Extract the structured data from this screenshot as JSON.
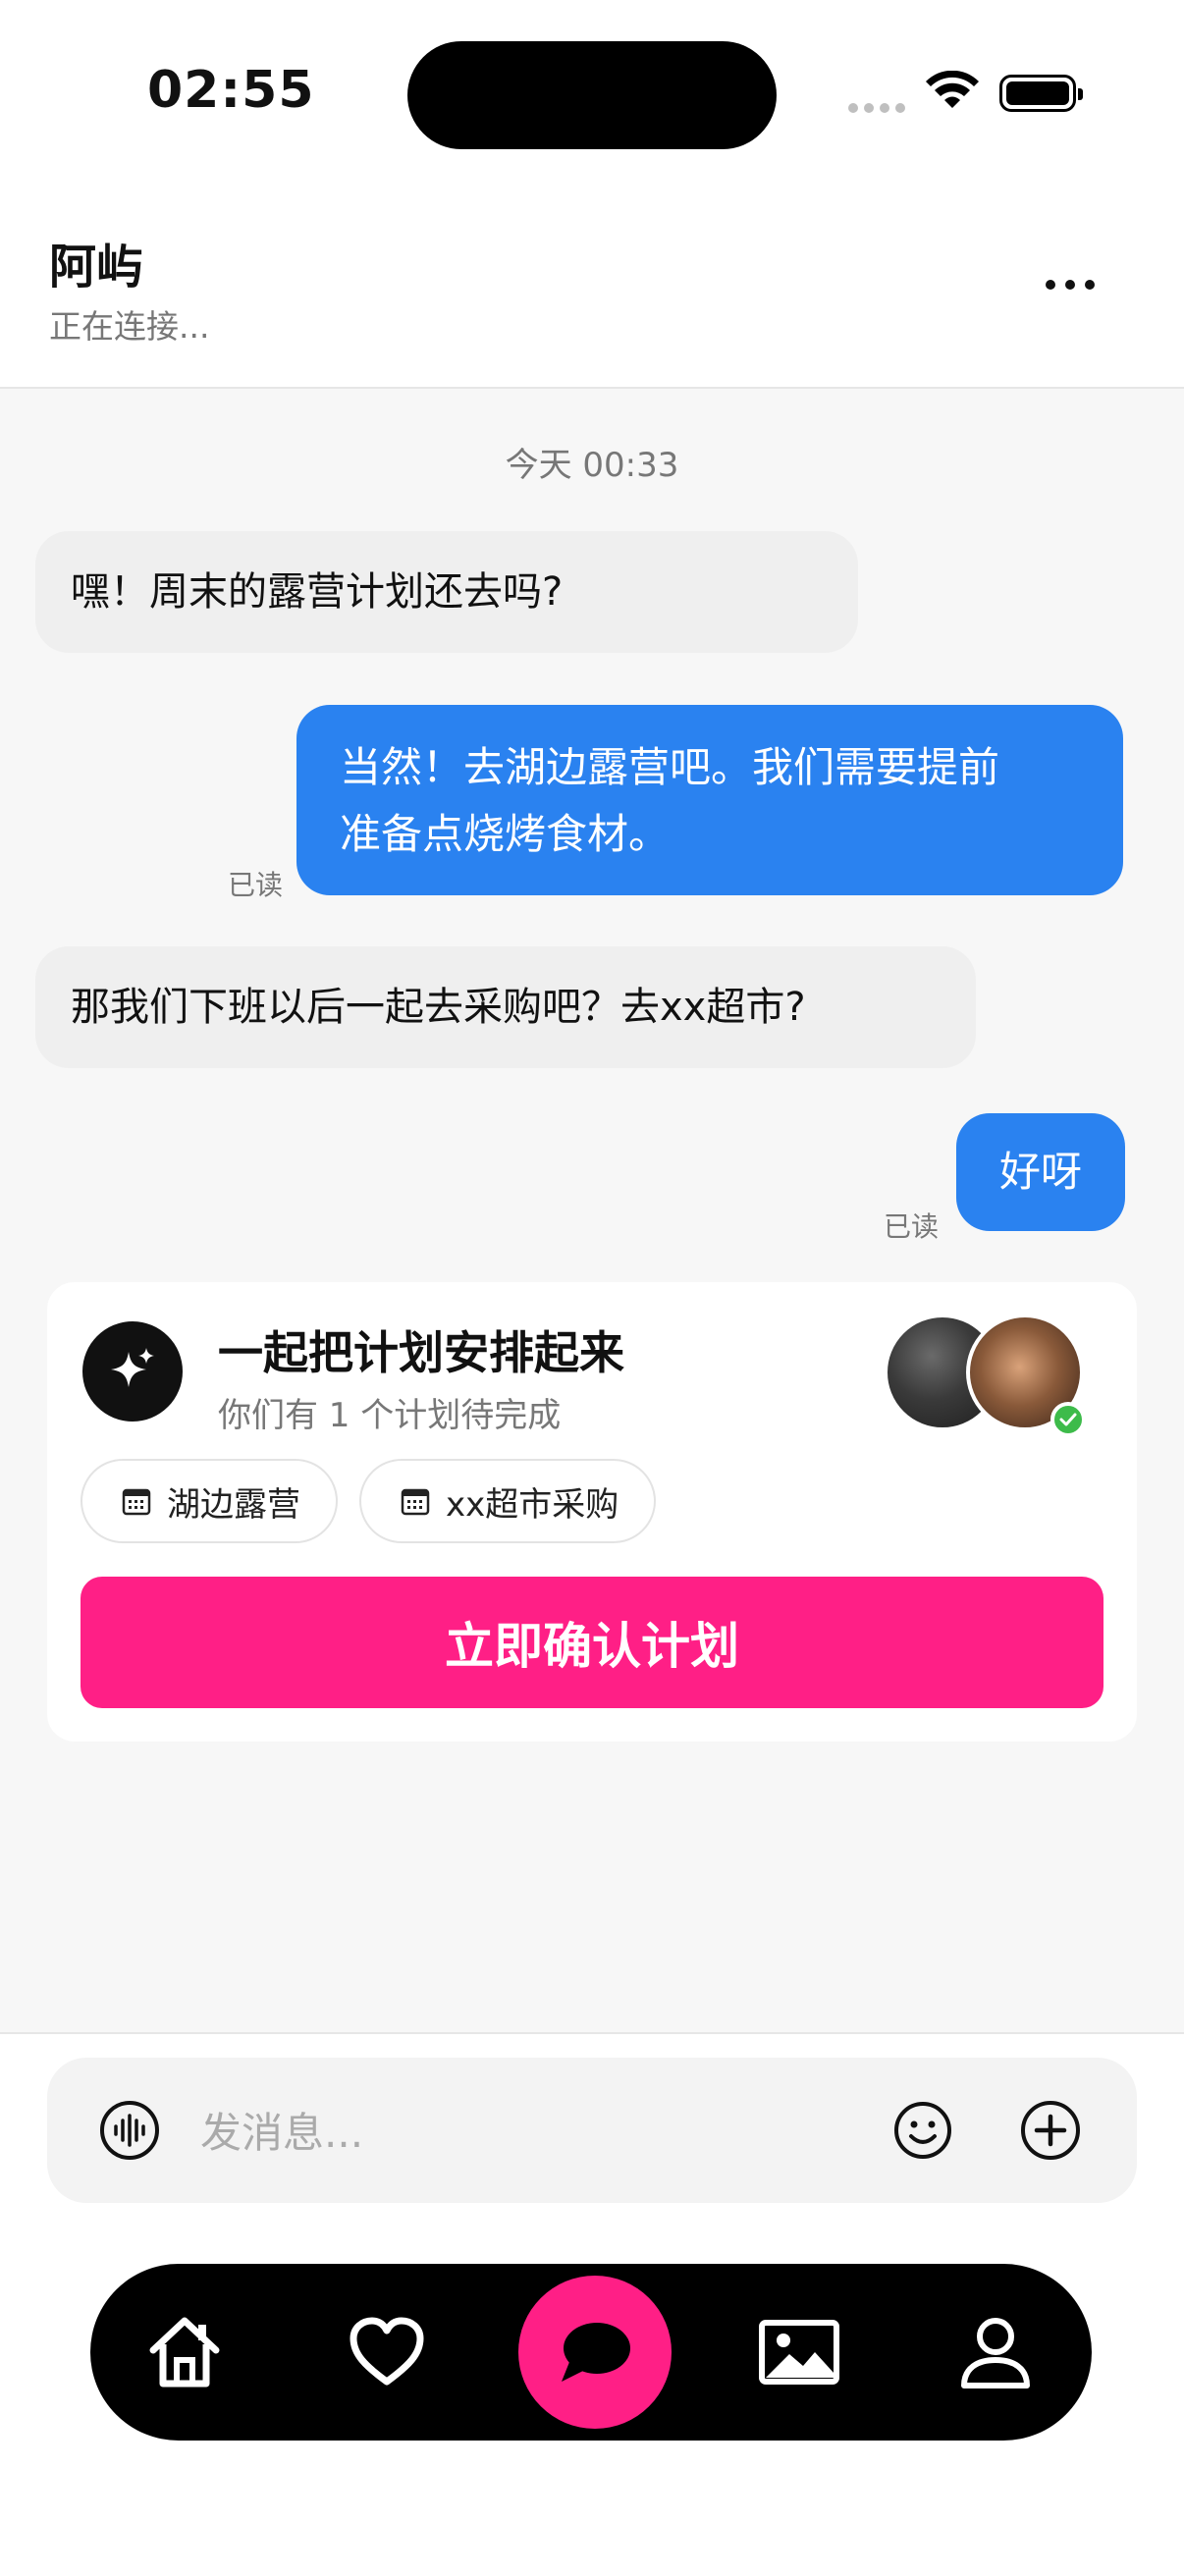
{
  "status_bar": {
    "time": "02:55"
  },
  "header": {
    "name": "阿屿",
    "status": "正在连接..."
  },
  "chat": {
    "time_separator": "今天 00:33",
    "messages": [
      {
        "side": "in",
        "text": "嘿！周末的露营计划还去吗?"
      },
      {
        "side": "out",
        "line1": "当然！去湖边露营吧。我们需要提前",
        "line2": "准备点烧烤食材。",
        "read": "已读"
      },
      {
        "side": "in",
        "text": "那我们下班以后一起去采购吧？去xx超市?"
      },
      {
        "side": "out",
        "text": "好呀",
        "read": "已读"
      }
    ]
  },
  "plan_card": {
    "title": "一起把计划安排起来",
    "subtitle": "你们有 1 个计划待完成",
    "tags": [
      "湖边露营",
      "xx超市采购"
    ],
    "confirm_label": "立即确认计划"
  },
  "input": {
    "placeholder": "发消息..."
  },
  "tabbar": {
    "active": "chat",
    "items": [
      "home-icon",
      "heart-icon",
      "chat-icon",
      "gallery-icon",
      "profile-icon"
    ]
  },
  "colors": {
    "accent_pink": "#ff1f86",
    "bubble_blue": "#2a82f0",
    "online_green": "#3dbb4a"
  }
}
